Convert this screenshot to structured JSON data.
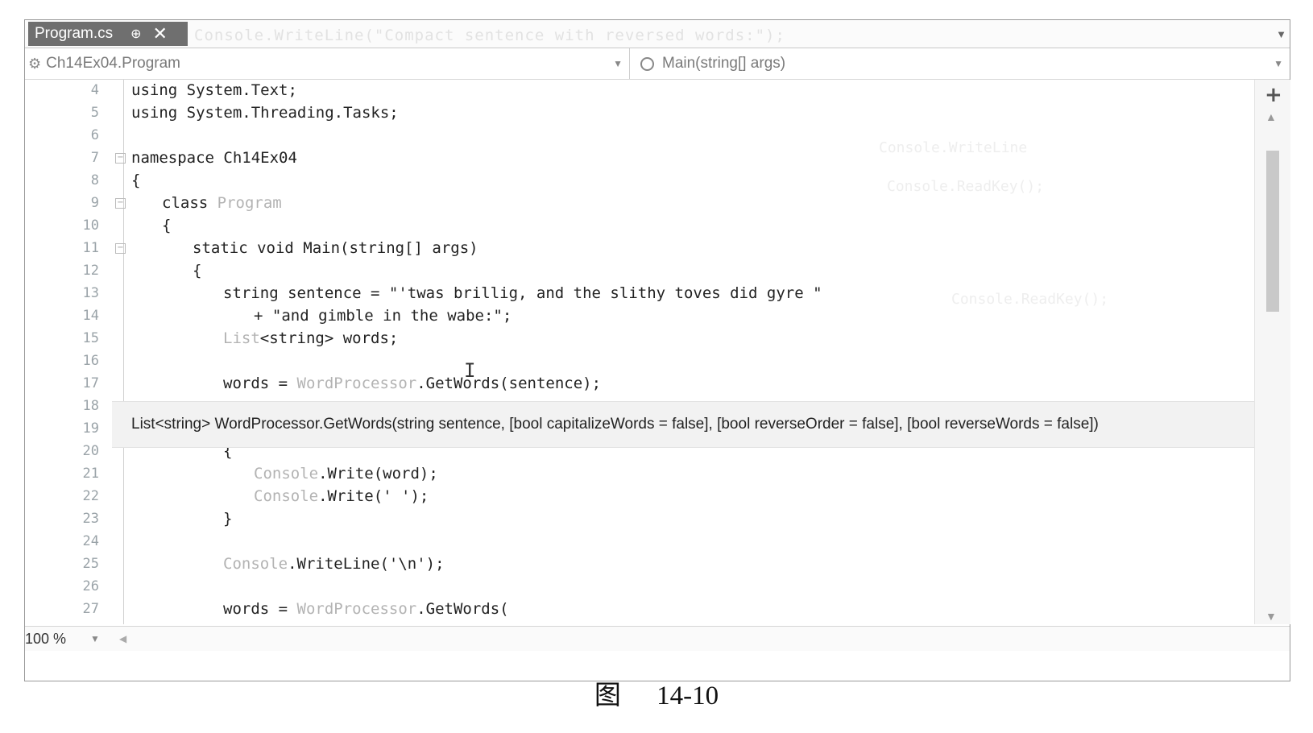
{
  "tab": {
    "title": "Program.cs",
    "pin_glyph": "⊕",
    "close_glyph": "✕"
  },
  "tabstrip": {
    "background_text": "Console.WriteLine(\"Compact sentence with reversed words:\");"
  },
  "navbar": {
    "class_path": "Ch14Ex04.Program",
    "member": "Main(string[] args)"
  },
  "code": {
    "lines": [
      {
        "n": "4",
        "text": "using System.Text;"
      },
      {
        "n": "5",
        "text": "using System.Threading.Tasks;"
      },
      {
        "n": "6",
        "text": ""
      },
      {
        "n": "7",
        "text": "namespace Ch14Ex04"
      },
      {
        "n": "8",
        "text": "{"
      },
      {
        "n": "9",
        "text": "class",
        "type": "Program"
      },
      {
        "n": "10",
        "text": "{"
      },
      {
        "n": "11",
        "text": "static void Main(string[] args)"
      },
      {
        "n": "12",
        "text": "{"
      },
      {
        "n": "13",
        "text": "string sentence = \"'twas brillig, and the slithy toves did gyre \""
      },
      {
        "n": "14",
        "text": "+ \"and gimble in the wabe:\";"
      },
      {
        "n": "15",
        "type": "List",
        "text": "<string> words;"
      },
      {
        "n": "16",
        "text": ""
      },
      {
        "n": "17",
        "pre": "words = ",
        "type": "WordProcessor",
        "text": ".GetWords(sentence);"
      },
      {
        "n": "18",
        "text": ""
      },
      {
        "n": "19",
        "text": ""
      },
      {
        "n": "20",
        "text": "{"
      },
      {
        "n": "21",
        "type": "Console",
        "text": ".Write(word);"
      },
      {
        "n": "22",
        "type": "Console",
        "text": ".Write(' ');"
      },
      {
        "n": "23",
        "text": "}"
      },
      {
        "n": "24",
        "text": ""
      },
      {
        "n": "25",
        "type": "Console",
        "text": ".WriteLine('\\n');"
      },
      {
        "n": "26",
        "text": ""
      },
      {
        "n": "27",
        "pre": "words = ",
        "type": "WordProcessor",
        "text": ".GetWords("
      }
    ]
  },
  "tooltip": {
    "text": "List<string> WordProcessor.GetWords(string sentence, [bool capitalizeWords = false], [bool reverseOrder = false], [bool reverseWords = false])"
  },
  "statusbar": {
    "zoom": "100 %"
  },
  "caption": {
    "fig": "图",
    "number": "14-10"
  },
  "icons": {
    "class": "class-icon",
    "method": "method-icon",
    "split": "split-view-icon",
    "cursor": "text-cursor-icon"
  }
}
